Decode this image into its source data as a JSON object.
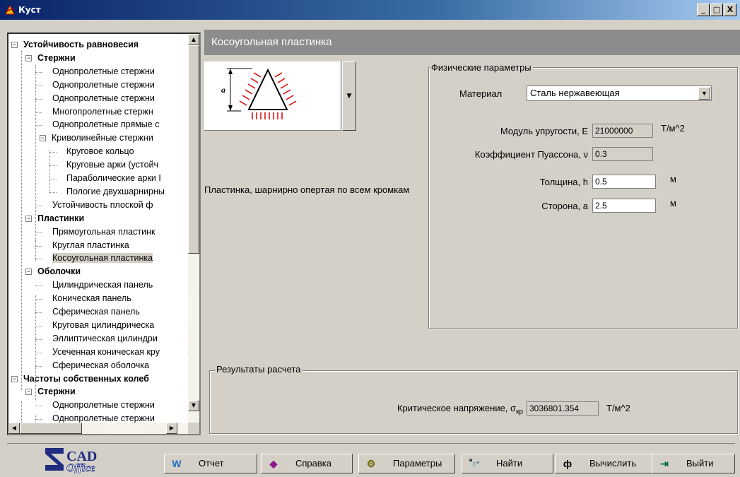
{
  "window": {
    "title": "Куст",
    "minimize": "_",
    "maximize": "□",
    "close": "X"
  },
  "tree": {
    "items": [
      {
        "label": "Устойчивость равновесия",
        "level": 0,
        "bold": true,
        "toggle": "−"
      },
      {
        "label": "Стержни",
        "level": 1,
        "bold": true,
        "toggle": "−"
      },
      {
        "label": "Однопролетные стержни",
        "level": 2
      },
      {
        "label": "Однопролетные стержни",
        "level": 2
      },
      {
        "label": "Однопролетные стержни",
        "level": 2
      },
      {
        "label": "Многопролетные стержн",
        "level": 2
      },
      {
        "label": "Однопролетные прямые с",
        "level": 2
      },
      {
        "label": "Криволинейные стержни",
        "level": 2,
        "toggle": "−"
      },
      {
        "label": "Круговое кольцо",
        "level": 3
      },
      {
        "label": "Круговые арки (устойч",
        "level": 3
      },
      {
        "label": "Параболические арки I",
        "level": 3
      },
      {
        "label": "Пологие двухшарнирны",
        "level": 3
      },
      {
        "label": "Устойчивость плоской ф",
        "level": 2
      },
      {
        "label": "Пластинки",
        "level": 1,
        "bold": true,
        "toggle": "−"
      },
      {
        "label": "Прямоугольная пластинк",
        "level": 2
      },
      {
        "label": "Круглая пластинка",
        "level": 2
      },
      {
        "label": "Косоугольная пластинка",
        "level": 2,
        "selected": true
      },
      {
        "label": "Оболочки",
        "level": 1,
        "bold": true,
        "toggle": "−"
      },
      {
        "label": "Цилиндрическая панель",
        "level": 2
      },
      {
        "label": "Коническая панель",
        "level": 2
      },
      {
        "label": "Сферическая панель",
        "level": 2
      },
      {
        "label": "Круговая цилиндрическа",
        "level": 2
      },
      {
        "label": "Эллиптическая цилиндри",
        "level": 2
      },
      {
        "label": "Усеченная коническая кру",
        "level": 2
      },
      {
        "label": "Сферическая оболочка",
        "level": 2
      },
      {
        "label": "Частоты собственных колеб",
        "level": 0,
        "bold": true,
        "toggle": "−"
      },
      {
        "label": "Стержни",
        "level": 1,
        "bold": true,
        "toggle": "−"
      },
      {
        "label": "Однопролетные стержни",
        "level": 2
      },
      {
        "label": "Однопролетные стержни",
        "level": 2
      }
    ]
  },
  "main": {
    "header": "Косоугольная пластинка",
    "image": {
      "dimension_label": "a"
    },
    "description": "Пластинка, шарнирно опертая по всем кромкам",
    "physical": {
      "legend": "Физические параметры",
      "material_label": "Материал",
      "material_value": "Сталь нержавеющая",
      "fields": [
        {
          "label": "Модуль упругости, E",
          "value": "21000000",
          "unit": "Т/м^2",
          "readonly": true
        },
        {
          "label": "Коэффициент Пуассона, ν",
          "value": "0.3",
          "unit": "",
          "readonly": true
        },
        {
          "label": "Толщина, h",
          "value": "0.5",
          "unit": "м",
          "readonly": false
        },
        {
          "label": "Сторона, a",
          "value": "2.5",
          "unit": "м",
          "readonly": false
        }
      ]
    },
    "results": {
      "legend": "Результаты расчета",
      "label": "Критическое напряжение, σ",
      "subscript": "кр",
      "value": "3036801.354",
      "unit": "Т/м^2"
    }
  },
  "toolbar": {
    "logo_top": "CAD",
    "logo_bottom": "Office",
    "buttons": [
      {
        "label": "Отчет",
        "icon": "report-icon",
        "glyph": "W"
      },
      {
        "label": "Справка",
        "icon": "help-icon",
        "glyph": "◆"
      },
      {
        "label": "Параметры",
        "icon": "settings-icon",
        "glyph": "⚙"
      },
      {
        "label": "Найти",
        "icon": "find-icon",
        "glyph": "🔭"
      },
      {
        "label": "Вычислить",
        "icon": "calculate-icon",
        "glyph": "ф"
      },
      {
        "label": "Выйти",
        "icon": "exit-icon",
        "glyph": "⇥"
      }
    ]
  }
}
